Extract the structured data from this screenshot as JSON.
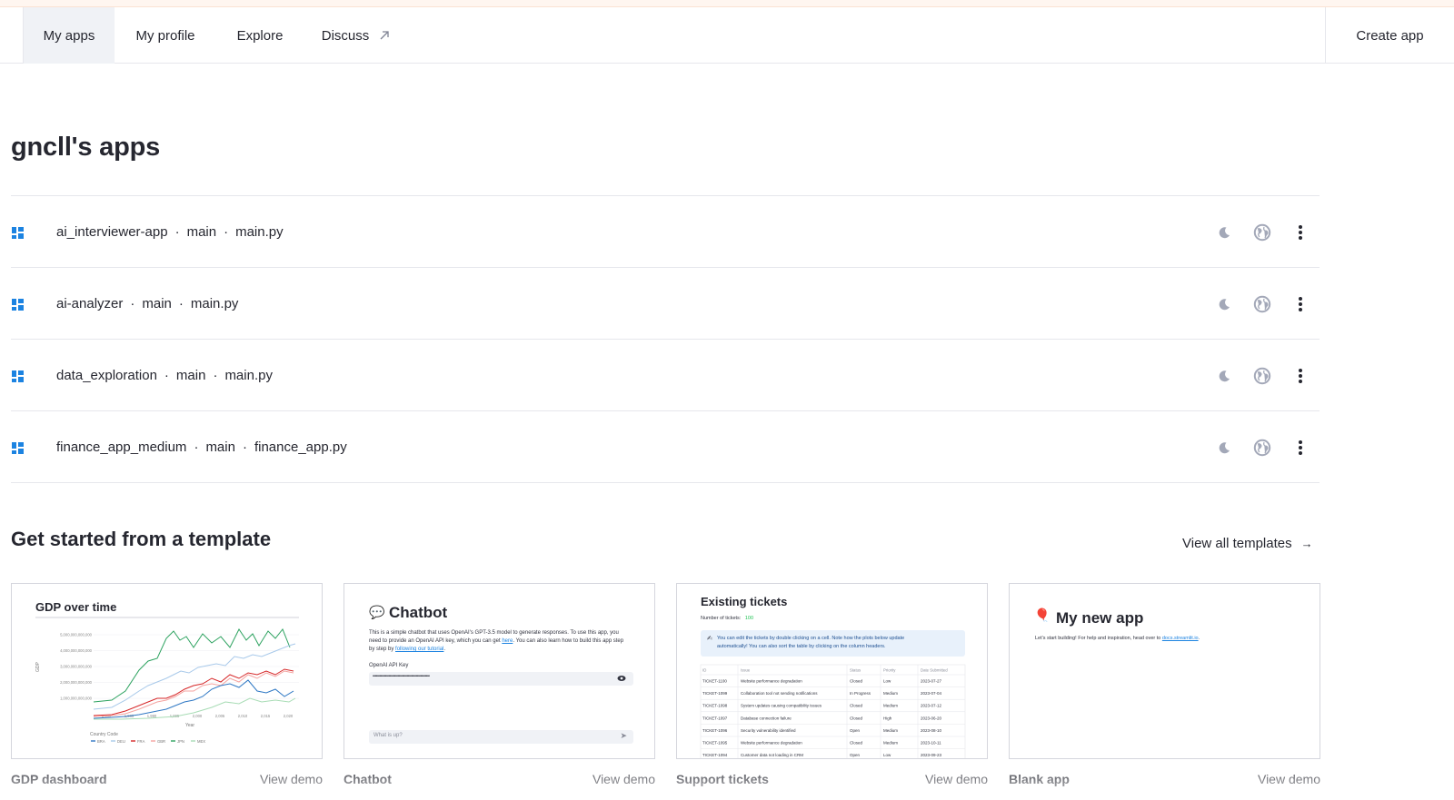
{
  "nav": {
    "tabs": [
      {
        "label": "My apps"
      },
      {
        "label": "My profile"
      },
      {
        "label": "Explore"
      },
      {
        "label": "Discuss"
      }
    ],
    "create_app": "Create app"
  },
  "page": {
    "title": "gncll's apps"
  },
  "apps": [
    {
      "name": "ai_interviewer-app",
      "branch": "main",
      "file": "main.py"
    },
    {
      "name": "ai-analyzer",
      "branch": "main",
      "file": "main.py"
    },
    {
      "name": "data_exploration",
      "branch": "main",
      "file": "main.py"
    },
    {
      "name": "finance_app_medium",
      "branch": "main",
      "file": "finance_app.py"
    }
  ],
  "separator": "·",
  "templates": {
    "title": "Get started from a template",
    "view_all": "View all templates",
    "view_demo": "View demo",
    "cards": [
      {
        "name": "GDP dashboard",
        "preview_title": "GDP over time",
        "y_ticks": [
          "5,000,000,000,000",
          "4,000,000,000,000",
          "3,000,000,000,000",
          "2,000,000,000,000",
          "1,000,000,000,000"
        ],
        "x_ticks": [
          "1,980",
          "1,985",
          "1,990",
          "1,995",
          "2,000",
          "2,005",
          "2,010",
          "2,015",
          "2,020"
        ],
        "y_label": "GDP",
        "x_label": "Year",
        "legend_title": "Country Code",
        "legend": [
          "BRA",
          "DEU",
          "FRA",
          "GBR",
          "JPN",
          "MEX"
        ]
      },
      {
        "name": "Chatbot",
        "preview_title": "Chatbot",
        "desc_1": "This is a simple chatbot that uses OpenAI's GPT-3.5 model to generate responses. To use this app, you",
        "desc_2": "need to provide an OpenAI API key, which you can get",
        "desc_link_1": "here",
        "desc_3": ". You can also learn how to build this app step",
        "desc_4": "by step by",
        "desc_link_2": "following our tutorial",
        "desc_5": ".",
        "key_label": "OpenAI API Key",
        "key_value": "••••••••••••••••••••••••••••••••••••••••••••••••••",
        "chat_placeholder": "What is up?"
      },
      {
        "name": "Support tickets",
        "preview_title": "Existing tickets",
        "count_label": "Number of tickets:",
        "count_value": "100",
        "info_1": "You can edit the tickets by double clicking on a cell. Note how the plots below update",
        "info_2": "automatically! You can also sort the table by clicking on the column headers.",
        "columns": [
          "ID",
          "Issue",
          "Status",
          "Priority",
          "Date Submitted"
        ],
        "rows": [
          [
            "TICKET-1100",
            "Website performance degradation",
            "Closed",
            "Low",
            "2023-07-27"
          ],
          [
            "TICKET-1099",
            "Collaboration tool not sending notifications",
            "In Progress",
            "Medium",
            "2023-07-04"
          ],
          [
            "TICKET-1098",
            "System updates causing compatibility issues",
            "Closed",
            "Medium",
            "2023-07-12"
          ],
          [
            "TICKET-1097",
            "Database connection failure",
            "Closed",
            "High",
            "2023-06-20"
          ],
          [
            "TICKET-1096",
            "Security vulnerability identified",
            "Open",
            "Medium",
            "2023-08-10"
          ],
          [
            "TICKET-1095",
            "Website performance degradation",
            "Closed",
            "Medium",
            "2023-10-11"
          ],
          [
            "TICKET-1094",
            "Customer data not loading in CRM",
            "Open",
            "Low",
            "2023-09-23"
          ]
        ]
      },
      {
        "name": "Blank app",
        "preview_title": "My new app",
        "desc": "Let's start building! For help and inspiration, head over to",
        "link": "docs.streamlit.io",
        "desc_end": "."
      }
    ]
  },
  "colors": {
    "accent": "#1c83e1",
    "text": "#262730",
    "border": "#e6e7ec",
    "icon_gray": "#a3a8b8",
    "series": {
      "BRA": "#2f78c4",
      "DEU": "#a8c9ea",
      "FRA": "#d62728",
      "GBR": "#f4a3a0",
      "JPN": "#2ca25f",
      "MEX": "#a8dcb5"
    }
  }
}
